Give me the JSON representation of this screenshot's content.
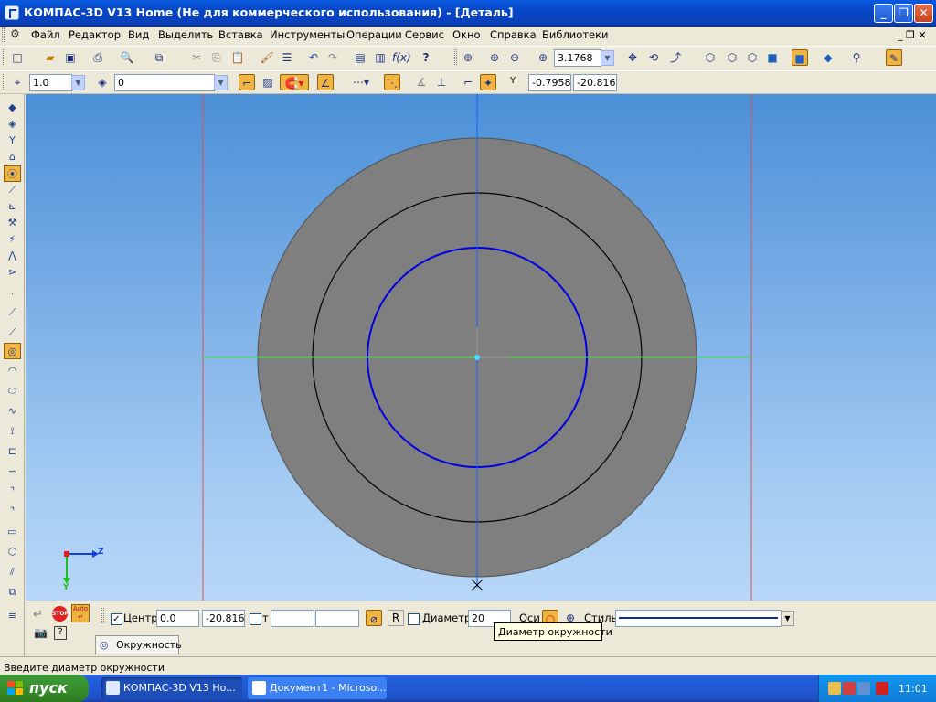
{
  "window": {
    "title": "КОМПАС-3D V13 Home (Не для коммерческого использования) - [Деталь]",
    "minimize": "_",
    "restore": "❐",
    "close": "✕"
  },
  "menu": {
    "items": [
      "Файл",
      "Редактор",
      "Вид",
      "Выделить",
      "Вставка",
      "Инструменты",
      "Операции",
      "Сервис",
      "Окно",
      "Справка",
      "Библиотеки"
    ],
    "mdi_controls": "_ ❐ ✕"
  },
  "toolbar_standard": {
    "zoom_value": "3.1768"
  },
  "toolbar_current": {
    "step_value": "1.0",
    "layer_value": "0",
    "coord_label": "Y",
    "coord_x": "-0.7958",
    "coord_y": "-20.816"
  },
  "axes": {
    "z_label": "Z",
    "y_label": "Y"
  },
  "props_panel": {
    "center_label": "Центр",
    "center_x": "0.0",
    "center_y": "-20.816",
    "t_label": "т",
    "point_x": "",
    "point_y": "",
    "r_label": "R",
    "diameter_label": "Диаметр",
    "diameter_value": "20",
    "axes_label": "Оси",
    "style_label": "Стиль",
    "tab_label": "Окружность",
    "tooltip": "Диаметр окружности"
  },
  "status": {
    "text": "Введите диаметр окружности"
  },
  "taskbar": {
    "start": "пуск",
    "tasks": [
      "КОМПАС-3D V13 Ho...",
      "Документ1 - Microso..."
    ],
    "clock": "11:01"
  },
  "colors": {
    "outer_disc": "#7f7f7f",
    "sketch_circle": "#000000",
    "new_circle": "#0000e0",
    "axis_vertical": "#1060ff",
    "axis_horizontal": "#40e040",
    "frame_lines": "#e05050"
  }
}
